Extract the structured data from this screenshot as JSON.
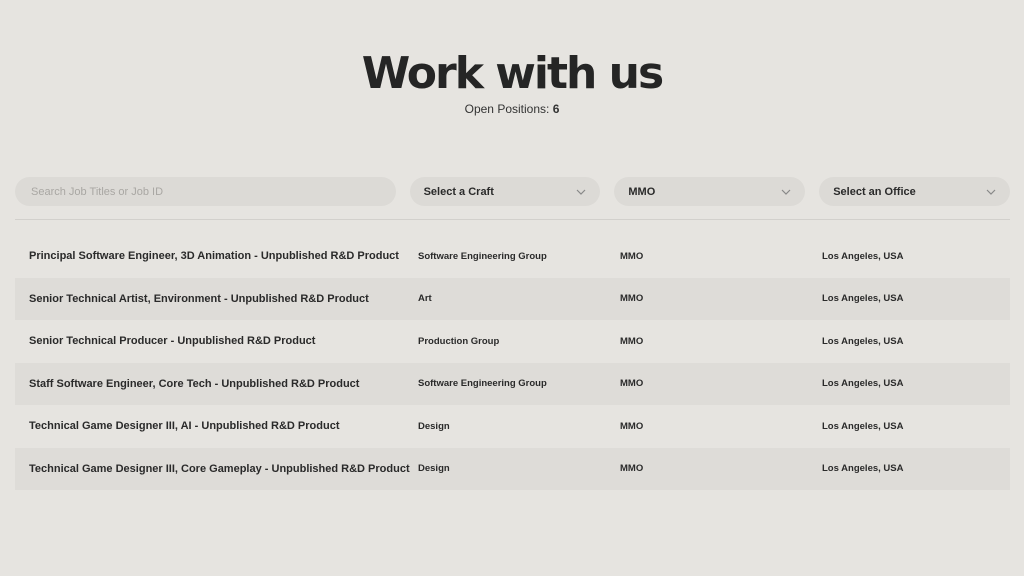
{
  "header": {
    "title": "Work with us",
    "open_positions_label": "Open Positions:",
    "open_positions_count": "6"
  },
  "filters": {
    "search_placeholder": "Search Job Titles or Job ID",
    "craft_label": "Select a Craft",
    "team_label": "MMO",
    "office_label": "Select an Office"
  },
  "jobs": [
    {
      "title": "Principal Software Engineer, 3D Animation - Unpublished R&D Product",
      "craft": "Software Engineering Group",
      "team": "MMO",
      "office": "Los Angeles, USA"
    },
    {
      "title": "Senior Technical Artist, Environment - Unpublished R&D Product",
      "craft": "Art",
      "team": "MMO",
      "office": "Los Angeles, USA"
    },
    {
      "title": "Senior Technical Producer - Unpublished R&D Product",
      "craft": "Production Group",
      "team": "MMO",
      "office": "Los Angeles, USA"
    },
    {
      "title": "Staff Software Engineer, Core Tech - Unpublished R&D Product",
      "craft": "Software Engineering Group",
      "team": "MMO",
      "office": "Los Angeles, USA"
    },
    {
      "title": "Technical Game Designer III, AI - Unpublished R&D Product",
      "craft": "Design",
      "team": "MMO",
      "office": "Los Angeles, USA"
    },
    {
      "title": "Technical Game Designer III, Core Gameplay - Unpublished R&D Product",
      "craft": "Design",
      "team": "MMO",
      "office": "Los Angeles, USA"
    }
  ]
}
